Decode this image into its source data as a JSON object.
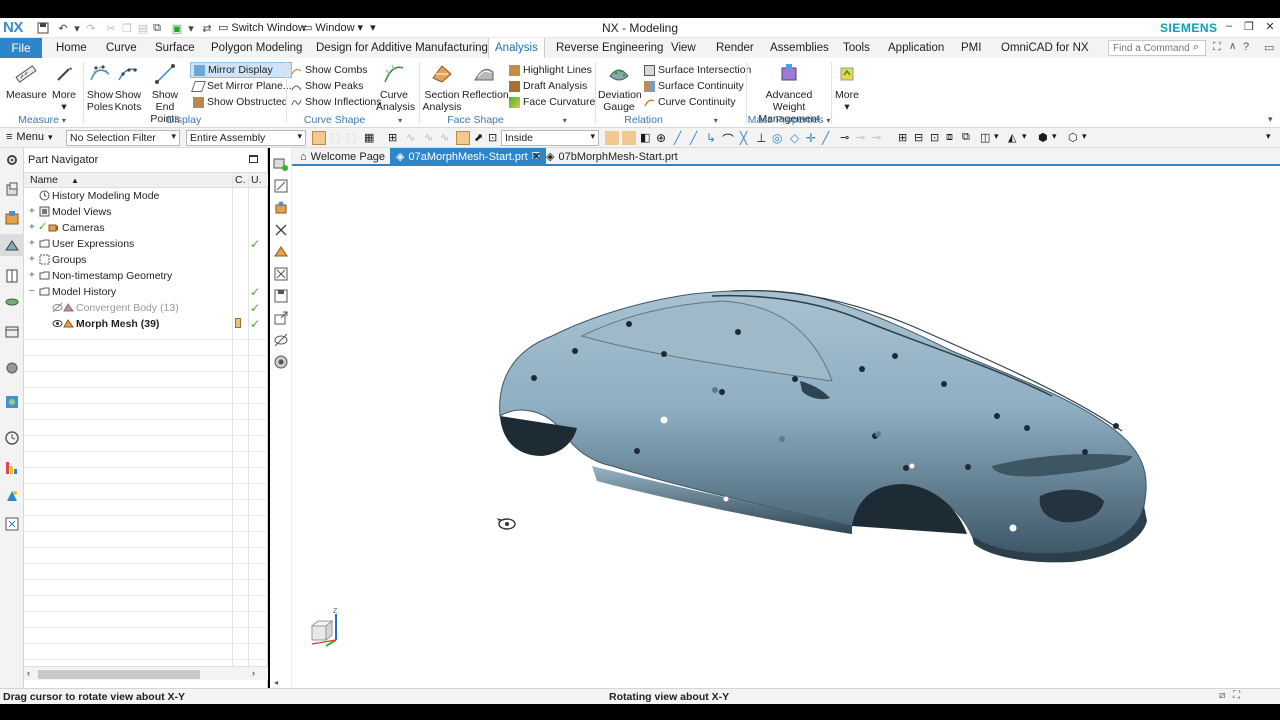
{
  "titlebar": {
    "logo": "NX",
    "switch_window": "Switch Window",
    "window_menu": "Window",
    "title": "NX - Modeling",
    "brand": "SIEMENS"
  },
  "tabs": {
    "file": "File",
    "items": [
      "Home",
      "Curve",
      "Surface",
      "Polygon Modeling",
      "Design for Additive Manufacturing",
      "Analysis",
      "Reverse Engineering",
      "View",
      "Render",
      "Assemblies",
      "Tools",
      "Application",
      "PMI",
      "OmniCAD for NX"
    ],
    "active": "Analysis",
    "find_placeholder": "Find a Command"
  },
  "ribbon": {
    "measure": "Measure",
    "more1": "More",
    "show_poles": [
      "Show",
      "Poles"
    ],
    "show_knots": [
      "Show",
      "Knots"
    ],
    "show_end_points": [
      "Show End",
      "Points"
    ],
    "mirror_display": "Mirror Display",
    "set_mirror_plane": "Set Mirror Plane...",
    "show_obstructed": "Show Obstructed",
    "show_combs": "Show Combs",
    "show_peaks": "Show Peaks",
    "show_inflections": "Show Inflections",
    "curve_analysis": [
      "Curve",
      "Analysis"
    ],
    "section_analysis": [
      "Section",
      "Analysis"
    ],
    "reflection": "Reflection",
    "highlight_lines": "Highlight Lines",
    "draft_analysis": "Draft Analysis",
    "face_curvature": "Face Curvature",
    "deviation_gauge": [
      "Deviation",
      "Gauge"
    ],
    "surface_intersection": "Surface Intersection",
    "surface_continuity": "Surface Continuity",
    "curve_continuity": "Curve Continuity",
    "advanced_weight": [
      "Advanced Weight",
      "Management"
    ],
    "more2": "More",
    "groups": {
      "measure": "Measure",
      "display": "Display",
      "curve_shape": "Curve Shape",
      "face_shape": "Face Shape",
      "relation": "Relation",
      "mass_properties": "Mass Properties"
    }
  },
  "selbar": {
    "menu": "Menu",
    "selection_filter": "No Selection Filter",
    "scope": "Entire Assembly",
    "inside": "Inside"
  },
  "navigator": {
    "title": "Part Navigator",
    "col_name": "Name",
    "col_c": "C.",
    "col_u": "U.",
    "rows": [
      {
        "label": "History Modeling Mode"
      },
      {
        "label": "Model Views"
      },
      {
        "label": "Cameras"
      },
      {
        "label": "User Expressions"
      },
      {
        "label": "Groups"
      },
      {
        "label": "Non-timestamp Geometry"
      },
      {
        "label": "Model History"
      },
      {
        "label": "Convergent Body (13)"
      },
      {
        "label": "Morph Mesh (39)"
      }
    ]
  },
  "doc_tabs": {
    "welcome": "Welcome Page",
    "active": "07aMorphMesh-Start.prt",
    "other": "07bMorphMesh-Start.prt"
  },
  "status": {
    "left": "Drag cursor to rotate view about X-Y",
    "middle": "Rotating view about X-Y"
  },
  "colors": {
    "accent": "#2e86c9",
    "brand": "#0aa0b5",
    "check": "#2fb52f",
    "model": "#8fb0c4"
  }
}
